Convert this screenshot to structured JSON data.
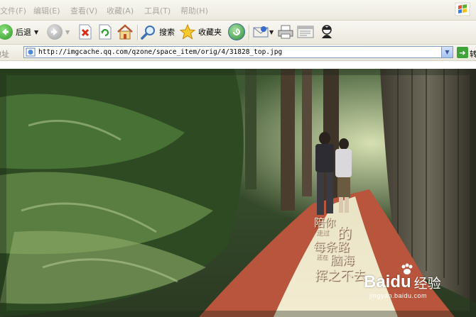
{
  "menu": {
    "items": [
      {
        "label": "文件(F)"
      },
      {
        "label": "编辑(E)"
      },
      {
        "label": "查看(V)"
      },
      {
        "label": "收藏(A)"
      },
      {
        "label": "工具(T)"
      },
      {
        "label": "帮助(H)"
      }
    ],
    "logo_icon": "windows-flag-icon"
  },
  "toolbar": {
    "back_label": "后退",
    "search_label": "搜索",
    "favorites_label": "收藏夹",
    "icons": [
      "back-arrow-icon",
      "forward-arrow-icon",
      "stop-icon",
      "refresh-icon",
      "home-icon",
      "search-icon",
      "star-icon",
      "history-icon",
      "mail-icon",
      "print-icon",
      "edit-icon",
      "messenger-icon"
    ]
  },
  "address": {
    "label": "地址",
    "url": "http://imgcache.qq.com/qzone/space_item/orig/4/31828_top.jpg",
    "go_label": "转"
  },
  "photo": {
    "caption_lines": [
      "陪你",
      "走过",
      "的",
      "每条路",
      "还在",
      "脑海",
      "挥之不去"
    ]
  },
  "watermark": {
    "brand": "Baidu",
    "product": "经验",
    "sub": "jingyan.baidu.com"
  },
  "colors": {
    "menu_text_disabled": "#aaa8a0",
    "toolbar_bg": "#ece9d8",
    "back_green": "#3fa23a",
    "path_orange": "#c2553a"
  }
}
